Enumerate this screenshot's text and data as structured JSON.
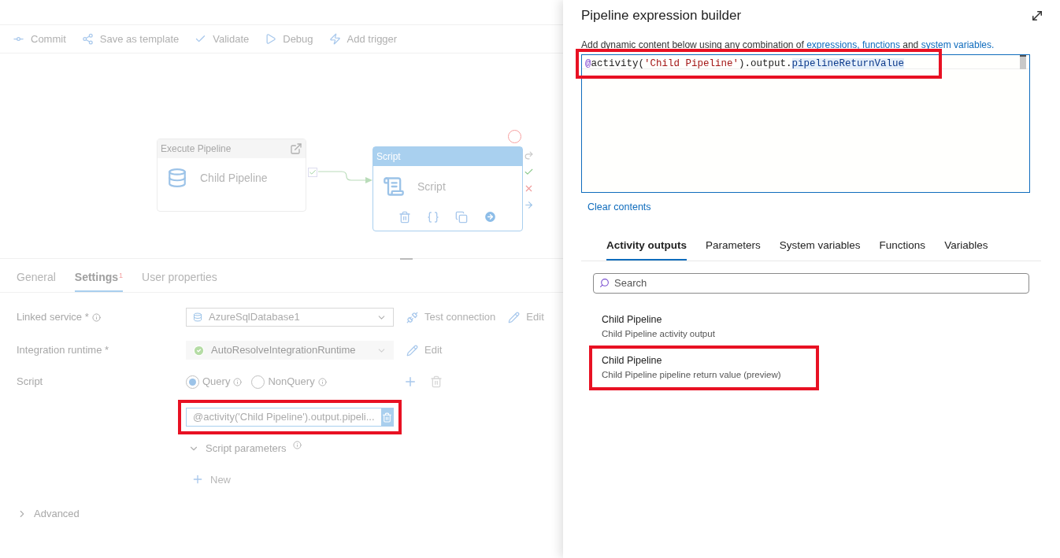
{
  "toolbar": [
    {
      "kind": "commit",
      "label": "Commit"
    },
    {
      "kind": "template",
      "label": "Save as template"
    },
    {
      "kind": "validate",
      "label": "Validate"
    },
    {
      "kind": "debug",
      "label": "Debug"
    },
    {
      "kind": "trigger",
      "label": "Add trigger"
    }
  ],
  "canvas": {
    "nodes": [
      {
        "kind": "execute",
        "header": "Execute Pipeline",
        "name": "Child Pipeline",
        "selected": false
      },
      {
        "kind": "script",
        "header": "Script",
        "name": "Script",
        "selected": true
      }
    ]
  },
  "bottom_tabs": [
    {
      "label": "General",
      "selected": false
    },
    {
      "label": "Settings",
      "selected": true,
      "badge": "1"
    },
    {
      "label": "User properties",
      "selected": false
    }
  ],
  "settings": {
    "linked_service": {
      "label": "Linked service *",
      "value": "AzureSqlDatabase1",
      "disabled": false,
      "actions": [
        "Test connection",
        "Edit"
      ]
    },
    "integration_runtime": {
      "label": "Integration runtime *",
      "value": "AutoResolveIntegrationRuntime",
      "disabled": true,
      "action": "Edit"
    },
    "script": {
      "label": "Script",
      "options": [
        {
          "label": "Query",
          "selected": true
        },
        {
          "label": "NonQuery",
          "selected": false
        }
      ],
      "value": "@activity('Child Pipeline').output.pipeli...",
      "params_label": "Script parameters",
      "new_label": "New"
    },
    "advanced": "Advanced"
  },
  "builder": {
    "title": "Pipeline expression builder",
    "description": [
      {
        "kind": "text",
        "text": "Add dynamic content below using any combination of "
      },
      {
        "kind": "link",
        "text": "expressions,"
      },
      {
        "kind": "link",
        "text": "functions"
      },
      {
        "kind": "text",
        "text": " and "
      },
      {
        "kind": "link",
        "text": "system variables."
      }
    ],
    "code": [
      {
        "kind": "at",
        "text": "@"
      },
      {
        "kind": "plain",
        "text": "activity("
      },
      {
        "kind": "string",
        "text": "'Child Pipeline'"
      },
      {
        "kind": "plain",
        "text": ").output."
      },
      {
        "kind": "highlight",
        "text": "pipelineReturnValue"
      }
    ],
    "clear": "Clear contents",
    "tabs": [
      {
        "label": "Activity outputs",
        "selected": true
      },
      {
        "label": "Parameters",
        "selected": false
      },
      {
        "label": "System variables",
        "selected": false
      },
      {
        "label": "Functions",
        "selected": false
      },
      {
        "label": "Variables",
        "selected": false
      }
    ],
    "search": {
      "placeholder": "Search"
    },
    "items": [
      {
        "title": "Child Pipeline",
        "subtitle": "Child Pipeline activity output",
        "highlighted": false
      },
      {
        "title": "Child Pipeline",
        "subtitle": "Child Pipeline pipeline return value (preview)",
        "highlighted": true
      }
    ]
  }
}
